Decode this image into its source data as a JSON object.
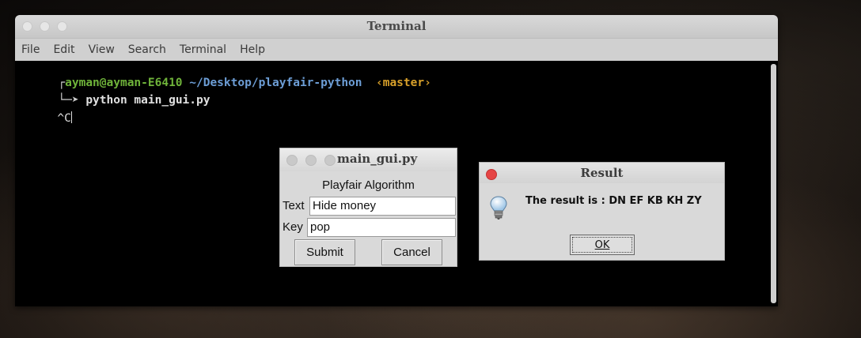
{
  "terminal": {
    "title": "Terminal",
    "menu": [
      "File",
      "Edit",
      "View",
      "Search",
      "Terminal",
      "Help"
    ],
    "prompt": {
      "user": "ayman@ayman-E6410",
      "path": "~/Desktop/playfair-python",
      "branch": "‹master›",
      "corner_top": "┌",
      "corner_bottom": "└─",
      "arrow": "➤"
    },
    "command": "python main_gui.py",
    "interrupt": "^C"
  },
  "gui_window": {
    "title": "main_gui.py",
    "heading": "Playfair Algorithm",
    "text_label": "Text",
    "text_value": "Hide money",
    "key_label": "Key",
    "key_value": "pop",
    "submit_label": "Submit",
    "cancel_label": "Cancel"
  },
  "result_dialog": {
    "title": "Result",
    "message": "The result is : DN EF KB KH ZY",
    "ok_label": "OK",
    "icon": "lightbulb-icon"
  },
  "colors": {
    "prompt_user": "#6fb33a",
    "prompt_path": "#6d9ed6",
    "prompt_branch": "#d8a02a",
    "close_button": "#e64545"
  }
}
